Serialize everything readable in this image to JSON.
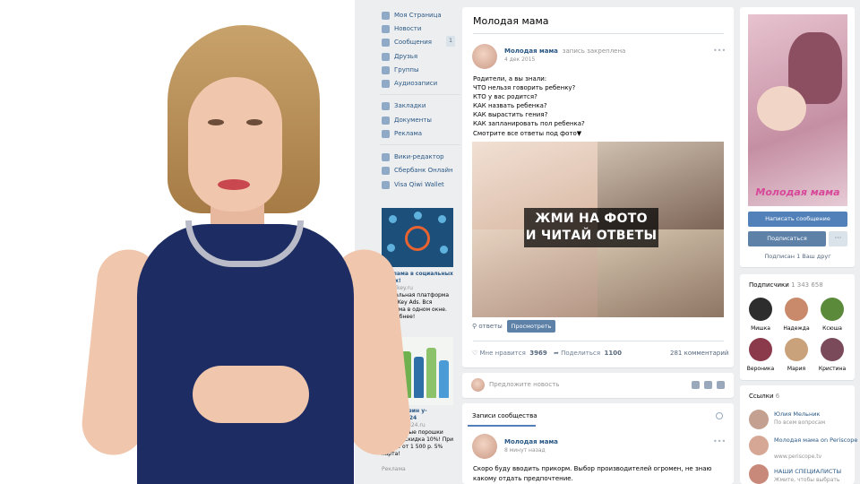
{
  "nav": {
    "items": [
      {
        "label": "Моя Страница",
        "icon": "home-icon"
      },
      {
        "label": "Новости",
        "icon": "news-icon"
      },
      {
        "label": "Сообщения",
        "icon": "messages-icon",
        "badge": "1"
      },
      {
        "label": "Друзья",
        "icon": "friends-icon"
      },
      {
        "label": "Группы",
        "icon": "groups-icon"
      },
      {
        "label": "Аудиозаписи",
        "icon": "music-icon"
      },
      {
        "label": "Закладки",
        "icon": "bookmark-icon"
      },
      {
        "label": "Документы",
        "icon": "document-icon"
      },
      {
        "label": "Реклама",
        "icon": "ads-icon"
      },
      {
        "label": "Вики-редактор",
        "icon": "app-icon"
      },
      {
        "label": "Сбербанк Онлайн",
        "icon": "app-icon"
      },
      {
        "label": "Visa Qiwi Wallet",
        "icon": "app-icon"
      }
    ],
    "ads_footer": "Реклама"
  },
  "ads": [
    {
      "title": "Реклама в социальных сетях!",
      "domain": "socialkey.ru",
      "text": "Уникальная платформа SocialKey Ads. Вся реклама в одном окне. Подробнее!"
    },
    {
      "title": "нет-магазин y-dostavka24",
      "domain": "y-dostavka24.ru",
      "text": "Стиральные порошки Amway. Скидка 10%! При заказе от 1 500 р. 5% карта!"
    }
  ],
  "post": {
    "page_title": "Молодая мама",
    "author": "Молодая мама",
    "pinned_label": "запись закреплена",
    "date": "4 дек 2015",
    "text_lines": [
      "Родители, а вы знали:",
      "ЧТО нельзя говорить ребенку?",
      "КТО у вас родится?",
      "КАК назвать ребенка?",
      "КАК вырастить гения?",
      "КАК запланировать пол ребенка?",
      "Смотрите все ответы под фото▼"
    ],
    "photo_caption_1": "ЖМИ НА ФОТО",
    "photo_caption_2": "И ЧИТАЙ ОТВЕТЫ",
    "answers_label": "ответы",
    "view_button": "Просмотреть",
    "likes_label": "Мне нравится",
    "likes": "3969",
    "shares_label": "Поделиться",
    "shares": "1100",
    "comments": "281 комментарий"
  },
  "suggest_placeholder": "Предложите новость",
  "community": {
    "tab_label": "Записи сообщества",
    "author": "Молодая мама",
    "time": "8 минут назад",
    "text": "Скоро буду вводить прикорм. Выбор производителей огромен, не знаю какому отдать предпочтение."
  },
  "sidebar": {
    "cover_title": "Молодая мама",
    "write_button": "Написать сообщение",
    "subscribe_button": "Подписаться",
    "more_button": "···",
    "friend_subscribed": "Подписан 1 Ваш друг",
    "subscribers_label": "Подписчики",
    "subscribers_count": "1 343 658",
    "subscribers": [
      {
        "name": "Мишка",
        "color": "#2d2d2d"
      },
      {
        "name": "Надежда",
        "color": "#c98a6b"
      },
      {
        "name": "Ксюша",
        "color": "#5a8a3a"
      },
      {
        "name": "Вероника",
        "color": "#8a3a4a"
      },
      {
        "name": "Мария",
        "color": "#c9a27b"
      },
      {
        "name": "Кристина",
        "color": "#7a4a5a"
      }
    ],
    "links_label": "Ссылки",
    "links_count": "6",
    "links": [
      {
        "title": "Юлия Мельник",
        "sub": "По всем вопросам"
      },
      {
        "title": "Молодая мама on Periscope",
        "sub": "www.periscope.tv"
      },
      {
        "title": "НАШИ СПЕЦИАЛИСТЫ",
        "sub": "Жмите, чтобы выбрать"
      }
    ]
  },
  "colors": {
    "accent": "#5181b8",
    "link": "#2a5885",
    "background": "#edeef0"
  }
}
